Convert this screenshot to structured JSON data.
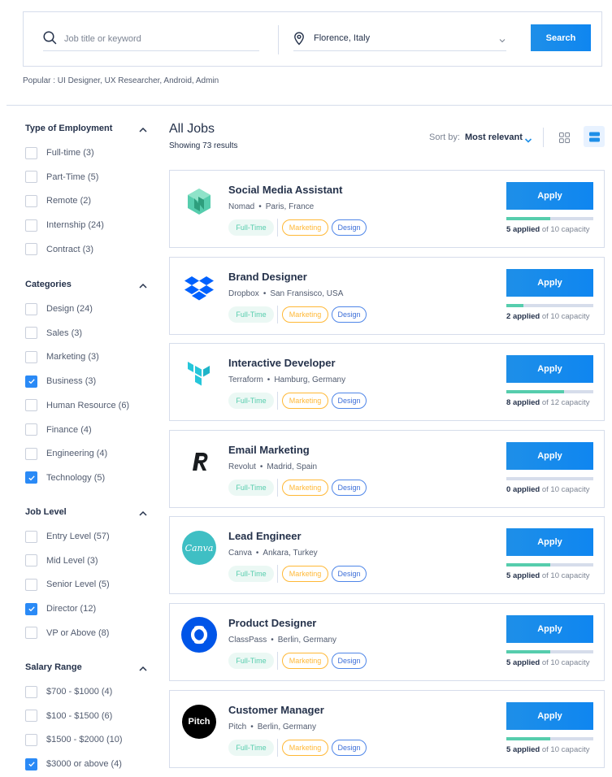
{
  "search": {
    "keyword_placeholder": "Job title or keyword",
    "keyword_value": "",
    "location": "Florence, Italy",
    "button": "Search",
    "popular": "Popular : UI Designer, UX Researcher, Android, Admin"
  },
  "filters": [
    {
      "title": "Type of Employment",
      "items": [
        {
          "label": "Full-time (3)",
          "checked": false
        },
        {
          "label": "Part-Time (5)",
          "checked": false
        },
        {
          "label": "Remote (2)",
          "checked": false
        },
        {
          "label": "Internship (24)",
          "checked": false
        },
        {
          "label": "Contract (3)",
          "checked": false
        }
      ]
    },
    {
      "title": "Categories",
      "items": [
        {
          "label": "Design (24)",
          "checked": false
        },
        {
          "label": "Sales (3)",
          "checked": false
        },
        {
          "label": "Marketing (3)",
          "checked": false
        },
        {
          "label": "Business (3)",
          "checked": true
        },
        {
          "label": "Human Resource (6)",
          "checked": false
        },
        {
          "label": "Finance (4)",
          "checked": false
        },
        {
          "label": "Engineering (4)",
          "checked": false
        },
        {
          "label": "Technology (5)",
          "checked": true
        }
      ]
    },
    {
      "title": "Job Level",
      "items": [
        {
          "label": "Entry Level (57)",
          "checked": false
        },
        {
          "label": "Mid Level (3)",
          "checked": false
        },
        {
          "label": "Senior Level (5)",
          "checked": false
        },
        {
          "label": "Director (12)",
          "checked": true
        },
        {
          "label": "VP or Above (8)",
          "checked": false
        }
      ]
    },
    {
      "title": "Salary Range",
      "items": [
        {
          "label": "$700 - $1000 (4)",
          "checked": false
        },
        {
          "label": "$100 - $1500 (6)",
          "checked": false
        },
        {
          "label": "$1500 - $2000 (10)",
          "checked": false
        },
        {
          "label": "$3000 or above (4)",
          "checked": true
        }
      ]
    }
  ],
  "main": {
    "title": "All Jobs",
    "subtitle": "Showing 73 results",
    "sort_label": "Sort by:",
    "sort_value": "Most relevant"
  },
  "jobs": [
    {
      "title": "Social Media Assistant",
      "company": "Nomad",
      "location": "Paris, France",
      "logo": "nomad-logo",
      "applied": 5,
      "capacity": 10
    },
    {
      "title": "Brand Designer",
      "company": "Dropbox",
      "location": "San Fransisco, USA",
      "logo": "dropbox-logo",
      "applied": 2,
      "capacity": 10
    },
    {
      "title": "Interactive Developer",
      "company": "Terraform",
      "location": "Hamburg, Germany",
      "logo": "terraform-logo",
      "applied": 8,
      "capacity": 12
    },
    {
      "title": "Email Marketing",
      "company": "Revolut",
      "location": "Madrid, Spain",
      "logo": "revolut-logo",
      "applied": 0,
      "capacity": 10
    },
    {
      "title": "Lead Engineer",
      "company": "Canva",
      "location": "Ankara, Turkey",
      "logo": "canva-logo",
      "applied": 5,
      "capacity": 10
    },
    {
      "title": "Product Designer",
      "company": "ClassPass",
      "location": "Berlin, Germany",
      "logo": "classpass-logo",
      "applied": 5,
      "capacity": 10
    },
    {
      "title": "Customer Manager",
      "company": "Pitch",
      "location": "Berlin, Germany",
      "logo": "pitch-logo",
      "applied": 5,
      "capacity": 10
    }
  ],
  "job_common": {
    "tags": [
      "Full-Time",
      "Marketing",
      "Design"
    ],
    "apply": "Apply",
    "applied_word": "applied",
    "of_word": "of",
    "capacity_word": "capacity",
    "separator": "•",
    "canva_text": "Canva",
    "pitch_text": "Pitch"
  },
  "colors": {
    "primary": "#1E8FE8",
    "fulltime": "#56CDAD",
    "marketing": "#FFB836",
    "design": "#4F86E8",
    "text": "#25324B"
  }
}
